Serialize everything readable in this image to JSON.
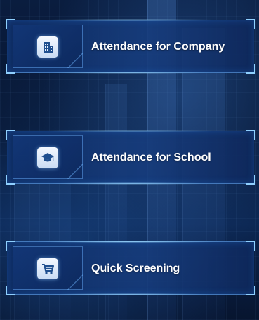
{
  "menu": {
    "items": [
      {
        "label": "Attendance for Company",
        "icon": "building-icon"
      },
      {
        "label": "Attendance for School",
        "icon": "graduation-cap-icon"
      },
      {
        "label": "Quick Screening",
        "icon": "shopping-cart-icon"
      }
    ]
  },
  "colors": {
    "background": "#06142e",
    "card": "#163c7d",
    "accent": "#8fd0ff",
    "text": "#ffffff",
    "icon_fill": "#1f4f8f"
  }
}
